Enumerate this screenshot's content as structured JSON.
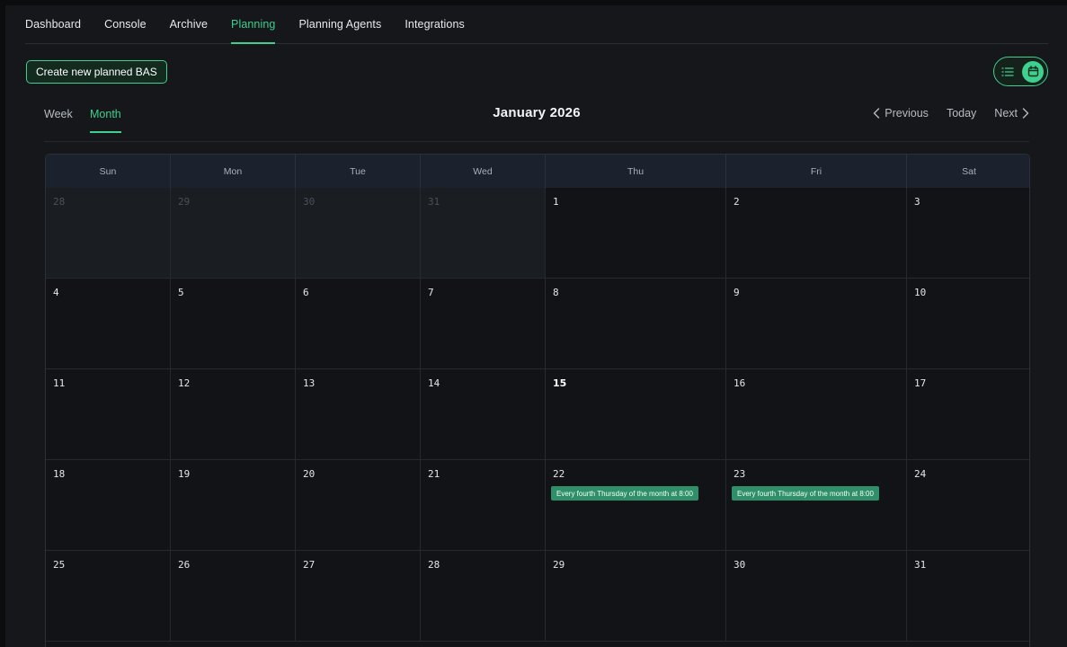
{
  "nav": {
    "tabs": [
      {
        "label": "Dashboard",
        "active": false
      },
      {
        "label": "Console",
        "active": false
      },
      {
        "label": "Archive",
        "active": false
      },
      {
        "label": "Planning",
        "active": true
      },
      {
        "label": "Planning Agents",
        "active": false
      },
      {
        "label": "Integrations",
        "active": false
      }
    ]
  },
  "toolbar": {
    "create_label": "Create new planned BAS",
    "view_toggle": {
      "options": [
        "list-icon",
        "calendar-icon"
      ],
      "selected": "calendar-icon"
    }
  },
  "calendar": {
    "view_tabs": [
      {
        "label": "Week",
        "active": false
      },
      {
        "label": "Month",
        "active": true
      }
    ],
    "title": "January 2026",
    "prev_label": "Previous",
    "today_label": "Today",
    "next_label": "Next",
    "weekdays": [
      "Sun",
      "Mon",
      "Tue",
      "Wed",
      "Thu",
      "Fri",
      "Sat"
    ],
    "weeks": [
      [
        {
          "day": "28",
          "outside": true
        },
        {
          "day": "29",
          "outside": true
        },
        {
          "day": "30",
          "outside": true
        },
        {
          "day": "31",
          "outside": true
        },
        {
          "day": "1"
        },
        {
          "day": "2"
        },
        {
          "day": "3"
        }
      ],
      [
        {
          "day": "4"
        },
        {
          "day": "5"
        },
        {
          "day": "6"
        },
        {
          "day": "7"
        },
        {
          "day": "8"
        },
        {
          "day": "9"
        },
        {
          "day": "10"
        }
      ],
      [
        {
          "day": "11"
        },
        {
          "day": "12"
        },
        {
          "day": "13"
        },
        {
          "day": "14"
        },
        {
          "day": "15",
          "today": true
        },
        {
          "day": "16"
        },
        {
          "day": "17"
        }
      ],
      [
        {
          "day": "18"
        },
        {
          "day": "19"
        },
        {
          "day": "20"
        },
        {
          "day": "21"
        },
        {
          "day": "22",
          "events": [
            "Every fourth Thursday of the month at 8:00"
          ]
        },
        {
          "day": "23",
          "events": [
            "Every fourth Thursday of the month at 8:00"
          ]
        },
        {
          "day": "24"
        }
      ],
      [
        {
          "day": "25"
        },
        {
          "day": "26"
        },
        {
          "day": "27"
        },
        {
          "day": "28"
        },
        {
          "day": "29"
        },
        {
          "day": "30"
        },
        {
          "day": "31"
        }
      ]
    ]
  },
  "colors": {
    "accent": "#3fcf8e",
    "event_bg": "#2f8f68",
    "background": "#15171a"
  }
}
